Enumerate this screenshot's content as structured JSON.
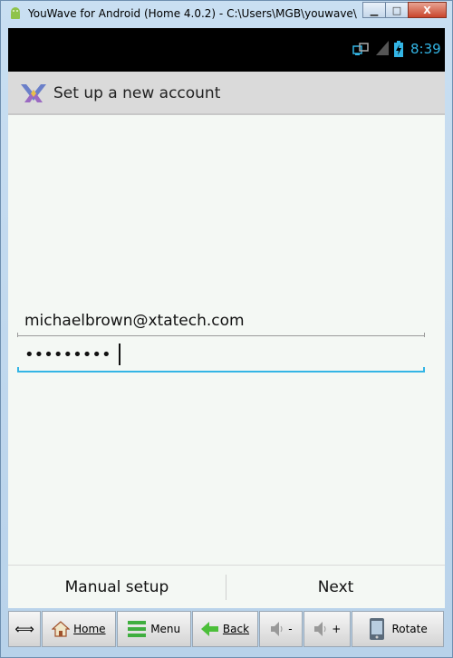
{
  "window": {
    "title": "YouWave for Android (Home 4.0.2) - C:\\Users\\MGB\\youwave\\",
    "minimize": "▁",
    "maximize": "□",
    "close": "X"
  },
  "statusbar": {
    "time": "8:39"
  },
  "actionbar": {
    "title": "Set up a new account"
  },
  "form": {
    "email_value": "michaelbrown@xtatech.com",
    "password_mask": "•••••••••"
  },
  "buttons": {
    "manual": "Manual setup",
    "next": "Next"
  },
  "toolbar": {
    "resize": "⟺",
    "home": "Home",
    "menu": "Menu",
    "back": "Back",
    "vol_down": "-",
    "vol_up": "+",
    "rotate": "Rotate"
  },
  "colors": {
    "accent": "#33b5e5",
    "statusbar": "#000000",
    "actionbar": "#dadada"
  }
}
